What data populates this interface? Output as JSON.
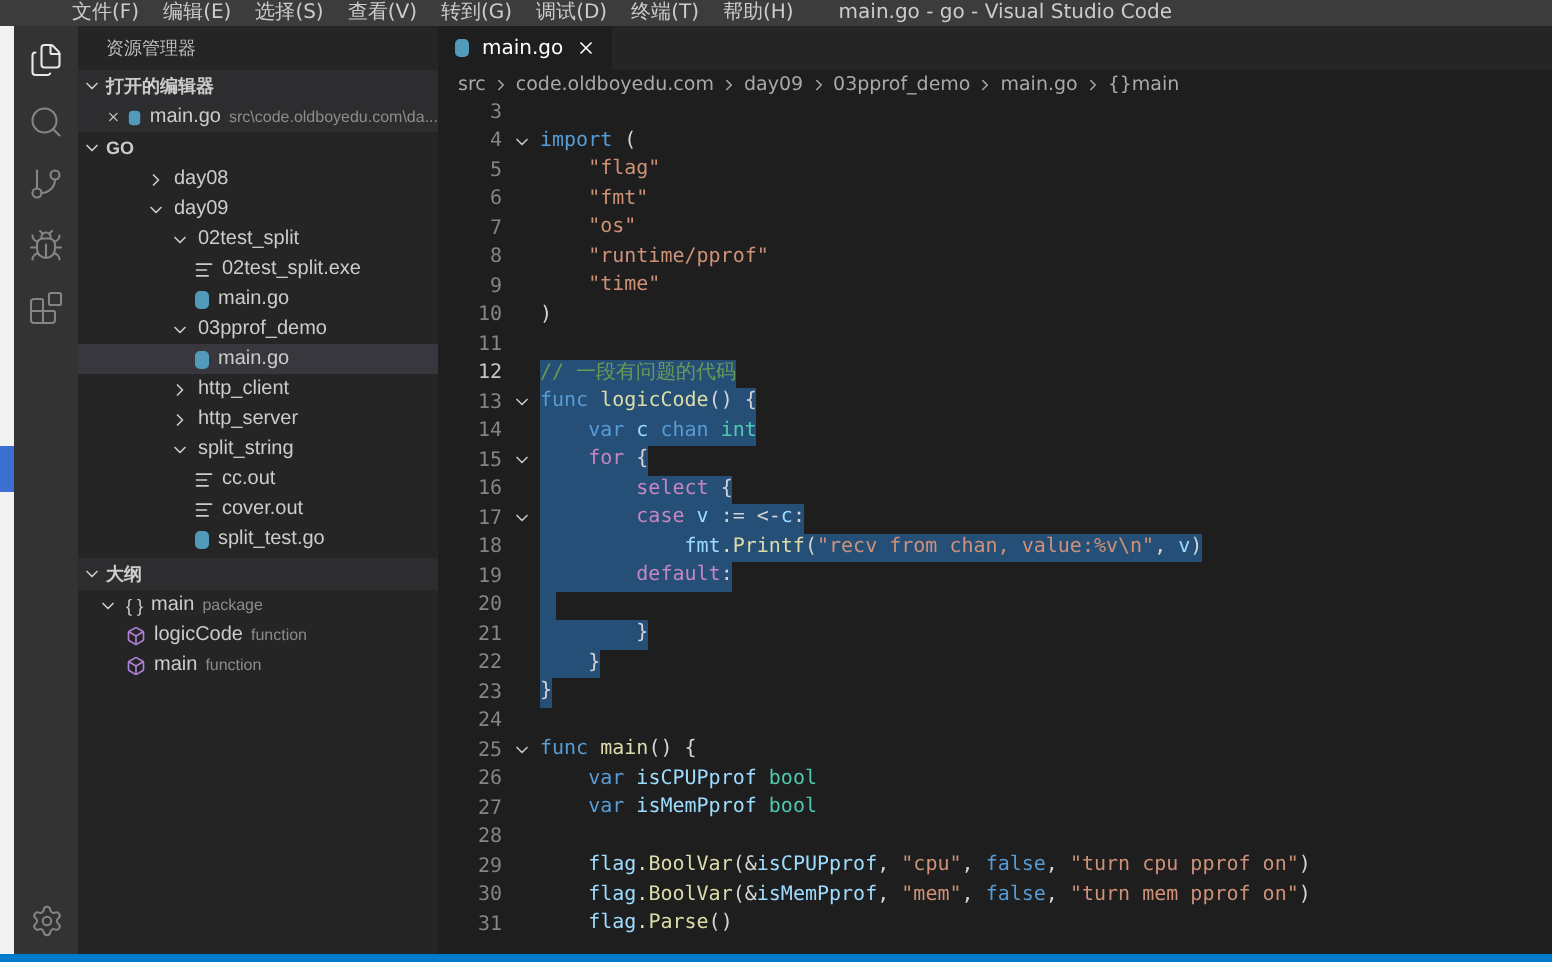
{
  "window": {
    "title": "main.go - go - Visual Studio Code",
    "menu": [
      "文件(F)",
      "编辑(E)",
      "选择(S)",
      "查看(V)",
      "转到(G)",
      "调试(D)",
      "终端(T)",
      "帮助(H)"
    ]
  },
  "activity_bar": [
    {
      "kind": "files",
      "selected": true
    },
    {
      "kind": "search",
      "selected": false
    },
    {
      "kind": "git",
      "selected": false
    },
    {
      "kind": "debug",
      "selected": false
    },
    {
      "kind": "extensions",
      "selected": false
    }
  ],
  "sidebar": {
    "title": "资源管理器",
    "open_editors": {
      "label": "打开的编辑器",
      "expanded": true,
      "items": [
        {
          "name": "main.go",
          "path": "src\\code.oldboyedu.com\\da..."
        }
      ]
    },
    "folder": {
      "label": "GO",
      "expanded": true,
      "items": [
        {
          "name": "day08",
          "kind": "folder",
          "expanded": false,
          "selected": false
        },
        {
          "name": "day09",
          "kind": "folder",
          "expanded": true,
          "selected": false,
          "children": [
            {
              "name": "02test_split",
              "kind": "folder",
              "expanded": true,
              "selected": false,
              "children": [
                {
                  "name": "02test_split.exe",
                  "kind": "file",
                  "selected": false
                },
                {
                  "name": "main.go",
                  "kind": "go",
                  "selected": false
                }
              ]
            },
            {
              "name": "03pprof_demo",
              "kind": "folder",
              "expanded": true,
              "selected": false,
              "children": [
                {
                  "name": "main.go",
                  "kind": "go",
                  "selected": true
                }
              ]
            },
            {
              "name": "http_client",
              "kind": "folder",
              "expanded": false,
              "selected": false
            },
            {
              "name": "http_server",
              "kind": "folder",
              "expanded": false,
              "selected": false
            },
            {
              "name": "split_string",
              "kind": "folder",
              "expanded": true,
              "selected": false,
              "children": [
                {
                  "name": "cc.out",
                  "kind": "file",
                  "selected": false
                },
                {
                  "name": "cover.out",
                  "kind": "file",
                  "selected": false
                },
                {
                  "name": "split_test.go",
                  "kind": "go",
                  "selected": false
                }
              ]
            }
          ]
        }
      ]
    },
    "outline": {
      "label": "大纲",
      "expanded": true,
      "items": [
        {
          "symbol": "{ }",
          "name": "main",
          "detail": "package",
          "kind": "package",
          "expanded": true,
          "children": [
            {
              "name": "logicCode",
              "detail": "function",
              "kind": "function"
            },
            {
              "name": "main",
              "detail": "function",
              "kind": "function"
            }
          ]
        }
      ]
    }
  },
  "tabs": [
    {
      "label": "main.go",
      "selected": true
    }
  ],
  "breadcrumb": [
    "src",
    "code.oldboyedu.com",
    "day09",
    "03pprof_demo",
    "main.go",
    "{}main"
  ],
  "code": [
    {
      "number": "3",
      "fold": false,
      "selected": false
    },
    {
      "number": "4",
      "fold": true,
      "selected": false,
      "tokens": [
        {
          "kind": "kw",
          "t": "import"
        },
        {
          "kind": "p",
          "t": " ("
        }
      ]
    },
    {
      "number": "5",
      "fold": false,
      "selected": false,
      "tokens": [
        {
          "kind": "str",
          "t": "    \"flag\""
        }
      ]
    },
    {
      "number": "6",
      "fold": false,
      "selected": false,
      "tokens": [
        {
          "kind": "str",
          "t": "    \"fmt\""
        }
      ]
    },
    {
      "number": "7",
      "fold": false,
      "selected": false,
      "tokens": [
        {
          "kind": "str",
          "t": "    \"os\""
        }
      ]
    },
    {
      "number": "8",
      "fold": false,
      "selected": false,
      "tokens": [
        {
          "kind": "str",
          "t": "    \"runtime/pprof\""
        }
      ]
    },
    {
      "number": "9",
      "fold": false,
      "selected": false,
      "tokens": [
        {
          "kind": "str",
          "t": "    \"time\""
        }
      ]
    },
    {
      "number": "10",
      "fold": false,
      "selected": false,
      "tokens": [
        {
          "kind": "p",
          "t": ")"
        }
      ]
    },
    {
      "number": "11",
      "fold": false,
      "selected": false
    },
    {
      "number": "12",
      "fold": false,
      "selected": true,
      "tokens": [
        {
          "kind": "com",
          "t": "// 一段有问题的代码"
        }
      ]
    },
    {
      "number": "13",
      "fold": true,
      "selected": true,
      "tokens": [
        {
          "kind": "kw",
          "t": "func"
        },
        {
          "kind": "fn",
          "t": " logicCode"
        },
        {
          "kind": "p",
          "t": "() {"
        }
      ]
    },
    {
      "number": "14",
      "fold": false,
      "selected": true,
      "tokens": [
        {
          "kind": "kw",
          "t": "    var"
        },
        {
          "kind": "var",
          "t": " c"
        },
        {
          "kind": "kw",
          "t": " chan"
        },
        {
          "kind": "type",
          "t": " int"
        }
      ]
    },
    {
      "number": "15",
      "fold": true,
      "selected": true,
      "tokens": [
        {
          "kind": "ctl",
          "t": "    for"
        },
        {
          "kind": "p",
          "t": " {"
        }
      ]
    },
    {
      "number": "16",
      "fold": false,
      "selected": true,
      "tokens": [
        {
          "kind": "ctl",
          "t": "        select"
        },
        {
          "kind": "p",
          "t": " {"
        }
      ]
    },
    {
      "number": "17",
      "fold": true,
      "selected": true,
      "tokens": [
        {
          "kind": "ctl",
          "t": "        case"
        },
        {
          "kind": "var",
          "t": " v"
        },
        {
          "kind": "p",
          "t": " := <-"
        },
        {
          "kind": "var",
          "t": "c"
        },
        {
          "kind": "p",
          "t": ":"
        }
      ]
    },
    {
      "number": "18",
      "fold": false,
      "selected": true,
      "tokens": [
        {
          "kind": "var",
          "t": "            fmt"
        },
        {
          "kind": "fn",
          "t": ".Printf"
        },
        {
          "kind": "p",
          "t": "("
        },
        {
          "kind": "str",
          "t": "\"recv from chan, value:%v\\n\""
        },
        {
          "kind": "p",
          "t": ", "
        },
        {
          "kind": "var",
          "t": "v"
        },
        {
          "kind": "p",
          "t": ")"
        }
      ]
    },
    {
      "number": "19",
      "fold": false,
      "selected": true,
      "tokens": [
        {
          "kind": "ctl",
          "t": "        default"
        },
        {
          "kind": "p",
          "t": ":"
        }
      ]
    },
    {
      "number": "20",
      "fold": false,
      "selected": true
    },
    {
      "number": "21",
      "fold": false,
      "selected": true,
      "tokens": [
        {
          "kind": "p",
          "t": "        }"
        }
      ]
    },
    {
      "number": "22",
      "fold": false,
      "selected": true,
      "tokens": [
        {
          "kind": "p",
          "t": "    }"
        }
      ]
    },
    {
      "number": "23",
      "fold": false,
      "selected": true,
      "tokens": [
        {
          "kind": "p",
          "t": "}"
        }
      ]
    },
    {
      "number": "24",
      "fold": false,
      "selected": false
    },
    {
      "number": "25",
      "fold": true,
      "selected": false,
      "tokens": [
        {
          "kind": "kw",
          "t": "func"
        },
        {
          "kind": "fn",
          "t": " main"
        },
        {
          "kind": "p",
          "t": "() {"
        }
      ]
    },
    {
      "number": "26",
      "fold": false,
      "selected": false,
      "tokens": [
        {
          "kind": "kw",
          "t": "    var"
        },
        {
          "kind": "var",
          "t": " isCPUPprof"
        },
        {
          "kind": "type",
          "t": " bool"
        }
      ]
    },
    {
      "number": "27",
      "fold": false,
      "selected": false,
      "tokens": [
        {
          "kind": "kw",
          "t": "    var"
        },
        {
          "kind": "var",
          "t": " isMemPprof"
        },
        {
          "kind": "type",
          "t": " bool"
        }
      ]
    },
    {
      "number": "28",
      "fold": false,
      "selected": false
    },
    {
      "number": "29",
      "fold": false,
      "selected": false,
      "tokens": [
        {
          "kind": "var",
          "t": "    flag"
        },
        {
          "kind": "fn",
          "t": ".BoolVar"
        },
        {
          "kind": "p",
          "t": "(&"
        },
        {
          "kind": "var",
          "t": "isCPUPprof"
        },
        {
          "kind": "p",
          "t": ", "
        },
        {
          "kind": "str",
          "t": "\"cpu\""
        },
        {
          "kind": "p",
          "t": ", "
        },
        {
          "kind": "kw",
          "t": "false"
        },
        {
          "kind": "p",
          "t": ", "
        },
        {
          "kind": "str",
          "t": "\"turn cpu pprof on\""
        },
        {
          "kind": "p",
          "t": ")"
        }
      ]
    },
    {
      "number": "30",
      "fold": false,
      "selected": false,
      "tokens": [
        {
          "kind": "var",
          "t": "    flag"
        },
        {
          "kind": "fn",
          "t": ".BoolVar"
        },
        {
          "kind": "p",
          "t": "(&"
        },
        {
          "kind": "var",
          "t": "isMemPprof"
        },
        {
          "kind": "p",
          "t": ", "
        },
        {
          "kind": "str",
          "t": "\"mem\""
        },
        {
          "kind": "p",
          "t": ", "
        },
        {
          "kind": "kw",
          "t": "false"
        },
        {
          "kind": "p",
          "t": ", "
        },
        {
          "kind": "str",
          "t": "\"turn mem pprof on\""
        },
        {
          "kind": "p",
          "t": ")"
        }
      ]
    },
    {
      "number": "31",
      "fold": false,
      "selected": false,
      "tokens": [
        {
          "kind": "var",
          "t": "    flag"
        },
        {
          "kind": "fn",
          "t": ".Parse"
        },
        {
          "kind": "p",
          "t": "()"
        }
      ]
    }
  ]
}
